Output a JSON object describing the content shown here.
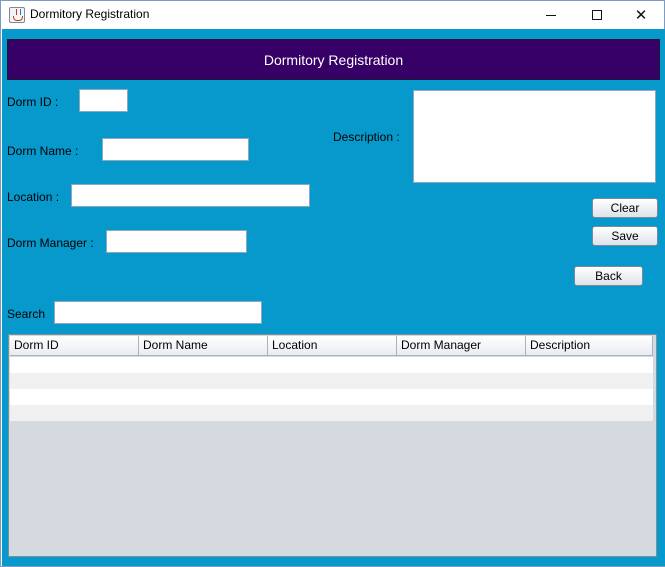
{
  "window": {
    "title": "Dormitory Registration",
    "app_icon": "java-cup-icon",
    "controls": {
      "minimize": "minimize-icon",
      "maximize": "maximize-icon",
      "close": "close-icon"
    }
  },
  "header": {
    "title": "Dormitory Registration"
  },
  "form": {
    "dorm_id_label": "Dorm ID :",
    "dorm_id_value": "",
    "dorm_name_label": "Dorm Name :",
    "dorm_name_value": "",
    "location_label": "Location :",
    "location_value": "",
    "dorm_manager_label": "Dorm Manager :",
    "dorm_manager_value": "",
    "description_label": "Description :",
    "description_value": ""
  },
  "buttons": {
    "clear": "Clear",
    "save": "Save",
    "back": "Back"
  },
  "search": {
    "label": "Search",
    "value": ""
  },
  "table": {
    "columns": [
      "Dorm ID",
      "Dorm Name",
      "Location",
      "Dorm Manager",
      "Description"
    ],
    "rows": [
      [
        "",
        "",
        "",
        "",
        ""
      ],
      [
        "",
        "",
        "",
        "",
        ""
      ],
      [
        "",
        "",
        "",
        "",
        ""
      ],
      [
        "",
        "",
        "",
        "",
        ""
      ]
    ]
  },
  "colors": {
    "content_background": "#0799cc",
    "header_background": "#360067",
    "header_text": "#ffffff",
    "table_empty_area": "#d5d9e0"
  }
}
